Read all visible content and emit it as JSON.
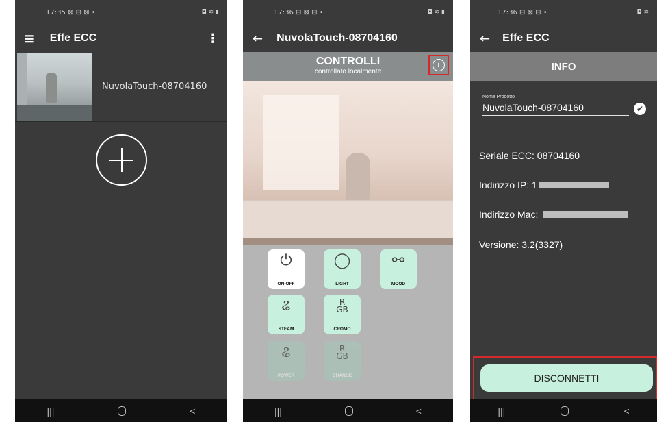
{
  "phone1": {
    "status": {
      "time": "17:35",
      "left_icons": "⊠ ⊟ ⊠ •",
      "right_icons": "◘ ≋ ▮"
    },
    "appbar": {
      "menu_icon": "≡",
      "title": "Effe ECC",
      "more_icon": "⋮"
    },
    "device": {
      "name": "NuvolaTouch-08704160"
    },
    "nav": {
      "recent": "|||",
      "back": "<"
    }
  },
  "phone2": {
    "status": {
      "time": "17:36",
      "left_icons": "⊟ ⊠ ⊟ •",
      "right_icons": "◘ ≋ ▮"
    },
    "appbar": {
      "back_icon": "←",
      "title": "NuvolaTouch-08704160"
    },
    "header": {
      "title": "CONTROLLI",
      "subtitle": "controllato localmente",
      "info_icon": "i"
    },
    "controls": [
      {
        "icon": "⏻",
        "label": "ON-OFF"
      },
      {
        "icon": "◯",
        "label": "LIGHT"
      },
      {
        "icon": "⚯",
        "label": "MOOD"
      },
      {
        "icon": "ଌ",
        "label": "STEAM"
      },
      {
        "icon": "R\nGB",
        "label": "CROMO"
      },
      {
        "icon": "ଌ",
        "label": "POWER"
      },
      {
        "icon": "R\nGB",
        "label": "CHANGE"
      }
    ],
    "nav": {
      "recent": "|||",
      "back": "<"
    }
  },
  "phone3": {
    "status": {
      "time": "17:36",
      "left_icons": "⊟ ⊠ ⊟ •",
      "right_icons": "◘ ≋"
    },
    "appbar": {
      "back_icon": "←",
      "title": "Effe ECC"
    },
    "header": {
      "title": "INFO"
    },
    "product_label": "Nome Prodotto",
    "product_name": "NuvolaTouch-08704160",
    "serial": "Seriale ECC: 08704160",
    "ip_label": "Indirizzo IP: ",
    "ip_value": "1",
    "mac_label": "Indirizzo Mac: ",
    "version": "Versione: 3.2(3327)",
    "disconnect": "DISCONNETTI",
    "nav": {
      "recent": "|||",
      "back": "<"
    }
  },
  "colors": {
    "background": "#3a3a3a",
    "accent": "#c8f0df",
    "highlight": "#d42a2a"
  }
}
